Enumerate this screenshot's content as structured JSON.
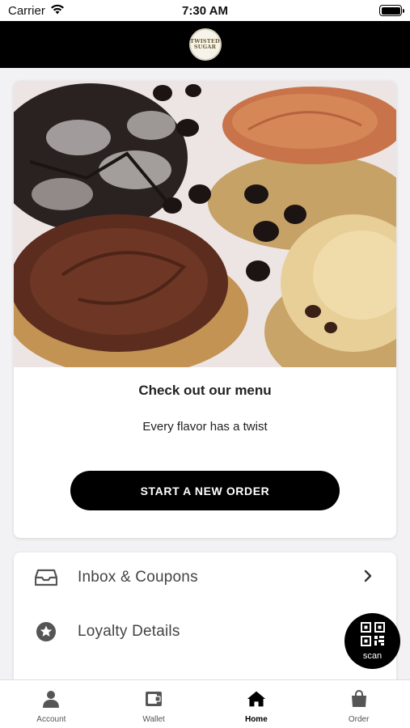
{
  "status_bar": {
    "carrier": "Carrier",
    "time": "7:30 AM"
  },
  "header": {
    "logo_line1": "TWISTED",
    "logo_line2": "SUGAR"
  },
  "menu_card": {
    "title": "Check out our menu",
    "subtitle": "Every flavor has a twist",
    "button_label": "START A NEW ORDER"
  },
  "list": {
    "items": [
      {
        "label": "Inbox & Coupons",
        "icon": "inbox-icon",
        "has_chevron": true
      },
      {
        "label": "Loyalty Details",
        "icon": "star-badge-icon",
        "has_chevron": false
      }
    ]
  },
  "scan_button": {
    "label": "scan",
    "icon": "qr-code-icon"
  },
  "tab_bar": {
    "tabs": [
      {
        "label": "Account",
        "icon": "person-icon",
        "active": false
      },
      {
        "label": "Wallet",
        "icon": "wallet-icon",
        "active": false
      },
      {
        "label": "Home",
        "icon": "home-icon",
        "active": true
      },
      {
        "label": "Order",
        "icon": "shopping-bag-icon",
        "active": false
      }
    ]
  },
  "colors": {
    "header_bg": "#000000",
    "button_bg": "#000000",
    "page_bg": "#f2f2f4"
  }
}
